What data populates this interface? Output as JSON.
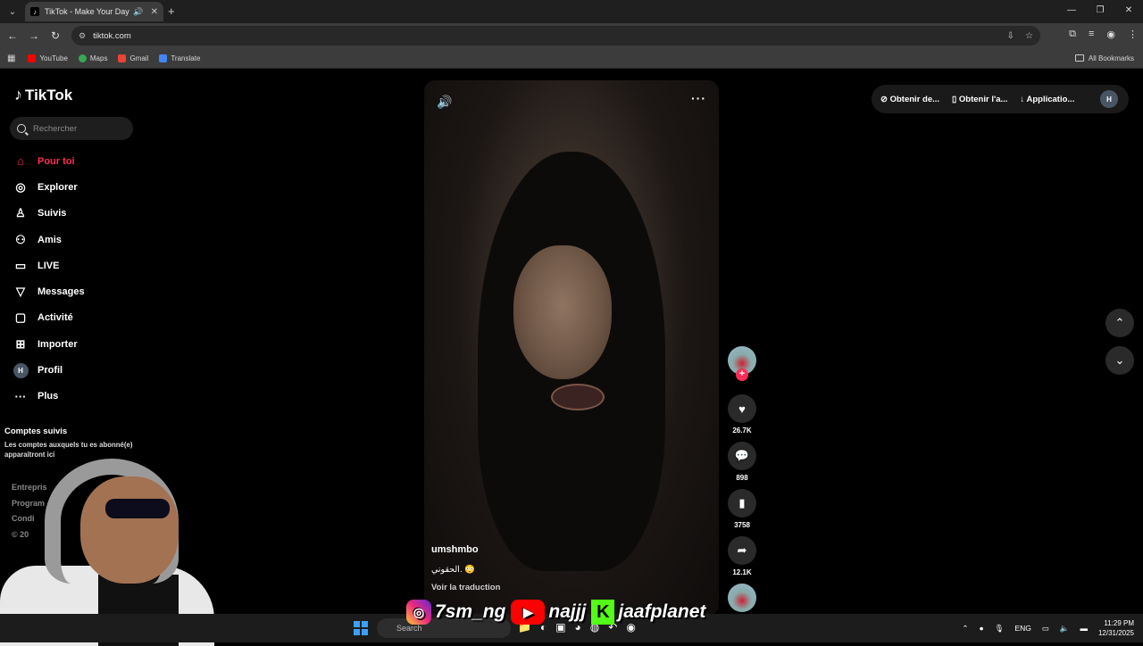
{
  "browser": {
    "tab_title": "TikTok - Make Your Day",
    "url": "tiktok.com",
    "bookmarks": [
      "YouTube",
      "Maps",
      "Gmail",
      "Translate"
    ],
    "all_bookmarks": "All Bookmarks"
  },
  "sidebar": {
    "logo": "TikTok",
    "search_placeholder": "Rechercher",
    "items": [
      {
        "label": "Pour toi",
        "icon": "home-icon"
      },
      {
        "label": "Explorer",
        "icon": "compass-icon"
      },
      {
        "label": "Suivis",
        "icon": "following-icon"
      },
      {
        "label": "Amis",
        "icon": "friends-icon"
      },
      {
        "label": "LIVE",
        "icon": "live-icon"
      },
      {
        "label": "Messages",
        "icon": "messages-icon"
      },
      {
        "label": "Activité",
        "icon": "activity-icon"
      },
      {
        "label": "Importer",
        "icon": "upload-icon"
      },
      {
        "label": "Profil",
        "icon": "profile-avatar"
      },
      {
        "label": "Plus",
        "icon": "more-icon"
      }
    ],
    "profile_initial": "H",
    "following_title": "Comptes suivis",
    "following_desc": "Les comptes auxquels tu es abonné(e) apparaîtront ici",
    "footer": [
      "Entrepris",
      "Program",
      "Condi",
      "© 20"
    ]
  },
  "video": {
    "username": "umshmbo",
    "caption": "الحقوني. 😳",
    "translate": "Voir la traduction"
  },
  "actions": {
    "likes": "26.7K",
    "comments": "898",
    "saves": "3758",
    "shares": "12.1K"
  },
  "topbar": {
    "item1": "Obtenir de...",
    "item2": "Obtenir l'a...",
    "item3": "Applicatio...",
    "avatar": "H"
  },
  "watermark": {
    "instagram": "7sm_ng",
    "youtube": "najjj",
    "kick": "jaafplanet"
  },
  "taskbar": {
    "search": "Search",
    "lang": "ENG",
    "time": "11:29 PM",
    "date": "12/31/2025"
  }
}
